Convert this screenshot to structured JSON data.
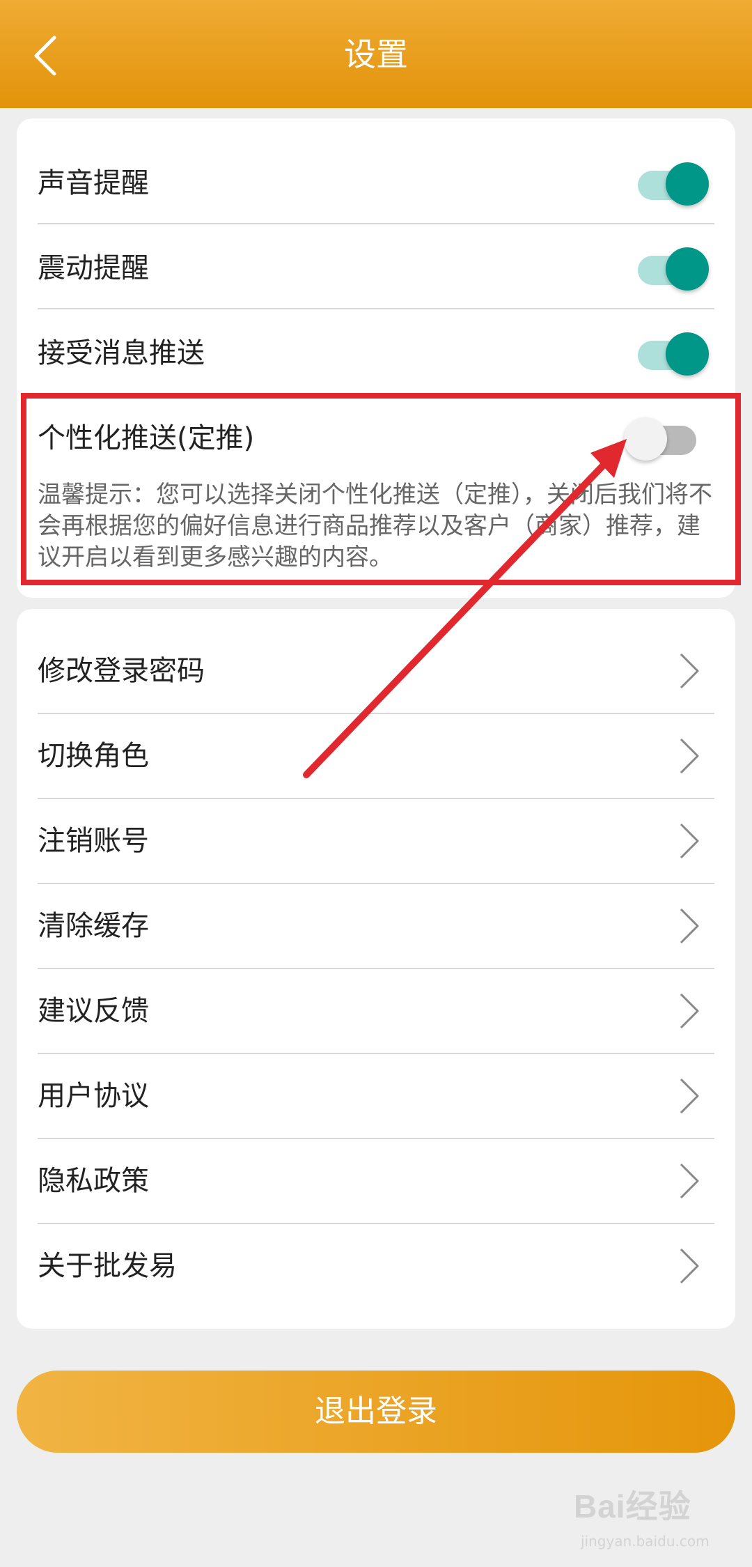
{
  "header": {
    "title": "设置"
  },
  "toggles": [
    {
      "label": "声音提醒",
      "on": true
    },
    {
      "label": "震动提醒",
      "on": true
    },
    {
      "label": "接受消息推送",
      "on": true
    },
    {
      "label": "个性化推送(定推)",
      "on": false
    }
  ],
  "personalized_hint": "温馨提示：您可以选择关闭个性化推送（定推），关闭后我们将不会再根据您的偏好信息进行商品推荐以及客户（商家）推荐，建议开启以看到更多感兴趣的内容。",
  "menu": [
    {
      "label": "修改登录密码"
    },
    {
      "label": "切换角色"
    },
    {
      "label": "注销账号"
    },
    {
      "label": "清除缓存"
    },
    {
      "label": "建议反馈"
    },
    {
      "label": "用户协议"
    },
    {
      "label": "隐私政策"
    },
    {
      "label": "关于批发易"
    }
  ],
  "logout_label": "退出登录",
  "watermark": {
    "brand": "Bai经验",
    "sub": "jingyan.baidu.com"
  },
  "colors": {
    "header": "#e89f1e",
    "toggle_on": "#009688",
    "toggle_off": "#b9b9b9",
    "annotation": "#e0282e",
    "logout": "#e89f1e"
  },
  "icons": {
    "back": "chevron-left-icon",
    "menu_arrow": "chevron-right-icon"
  }
}
